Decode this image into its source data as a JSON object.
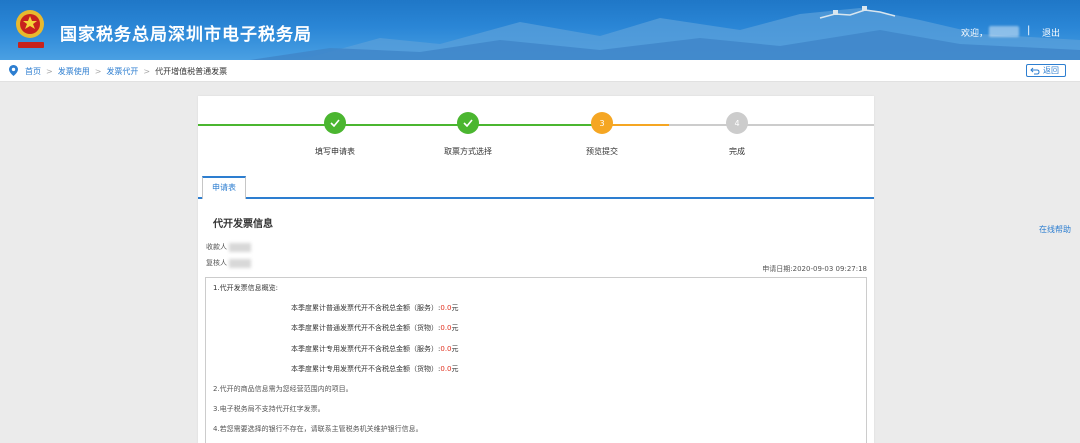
{
  "header": {
    "title": "国家税务总局深圳市电子税务局",
    "welcome": "欢迎，",
    "separator": "|",
    "logout": "退出"
  },
  "breadcrumb": {
    "items": [
      "首页",
      "发票使用",
      "发票代开"
    ],
    "current": "代开增值税普通发票",
    "back_label": "返回"
  },
  "steps": [
    {
      "label": "填写申请表",
      "state": "done",
      "num": "1"
    },
    {
      "label": "取票方式选择",
      "state": "done",
      "num": "2"
    },
    {
      "label": "预览提交",
      "state": "active",
      "num": "3"
    },
    {
      "label": "完成",
      "state": "pending",
      "num": "4"
    }
  ],
  "tab": {
    "label": "申请表"
  },
  "section": {
    "title": "代开发票信息",
    "payee_label": "收款人",
    "reviewer_label": "复核人",
    "apply_date": "申请日期:2020-09-03 09:27:18"
  },
  "notes": {
    "n1": "1.代开发票信息概览:",
    "quarter_lines": [
      {
        "text": "本季度累计普通发票代开不含税总金额（服务）:",
        "value": "0.0",
        "unit": "元"
      },
      {
        "text": "本季度累计普通发票代开不含税总金额（货物）:",
        "value": "0.0",
        "unit": "元"
      },
      {
        "text": "本季度累计专用发票代开不含税总金额（服务）:",
        "value": "0.0",
        "unit": "元"
      },
      {
        "text": "本季度累计专用发票代开不含税总金额（货物）:",
        "value": "0.0",
        "unit": "元"
      }
    ],
    "n2": "2.代开的商品信息需为您经营范围内的项目。",
    "n3": "3.电子税务局不支持代开红字发票。",
    "n4": "4.若您需要选择的银行不存在，请联系主管税务机关维护银行信息。"
  },
  "help": "在线帮助",
  "colors": {
    "done": "#4bb630",
    "active": "#f5a623",
    "pending": "#cccccc",
    "link": "#2d7ed0",
    "value": "#e0301e"
  }
}
